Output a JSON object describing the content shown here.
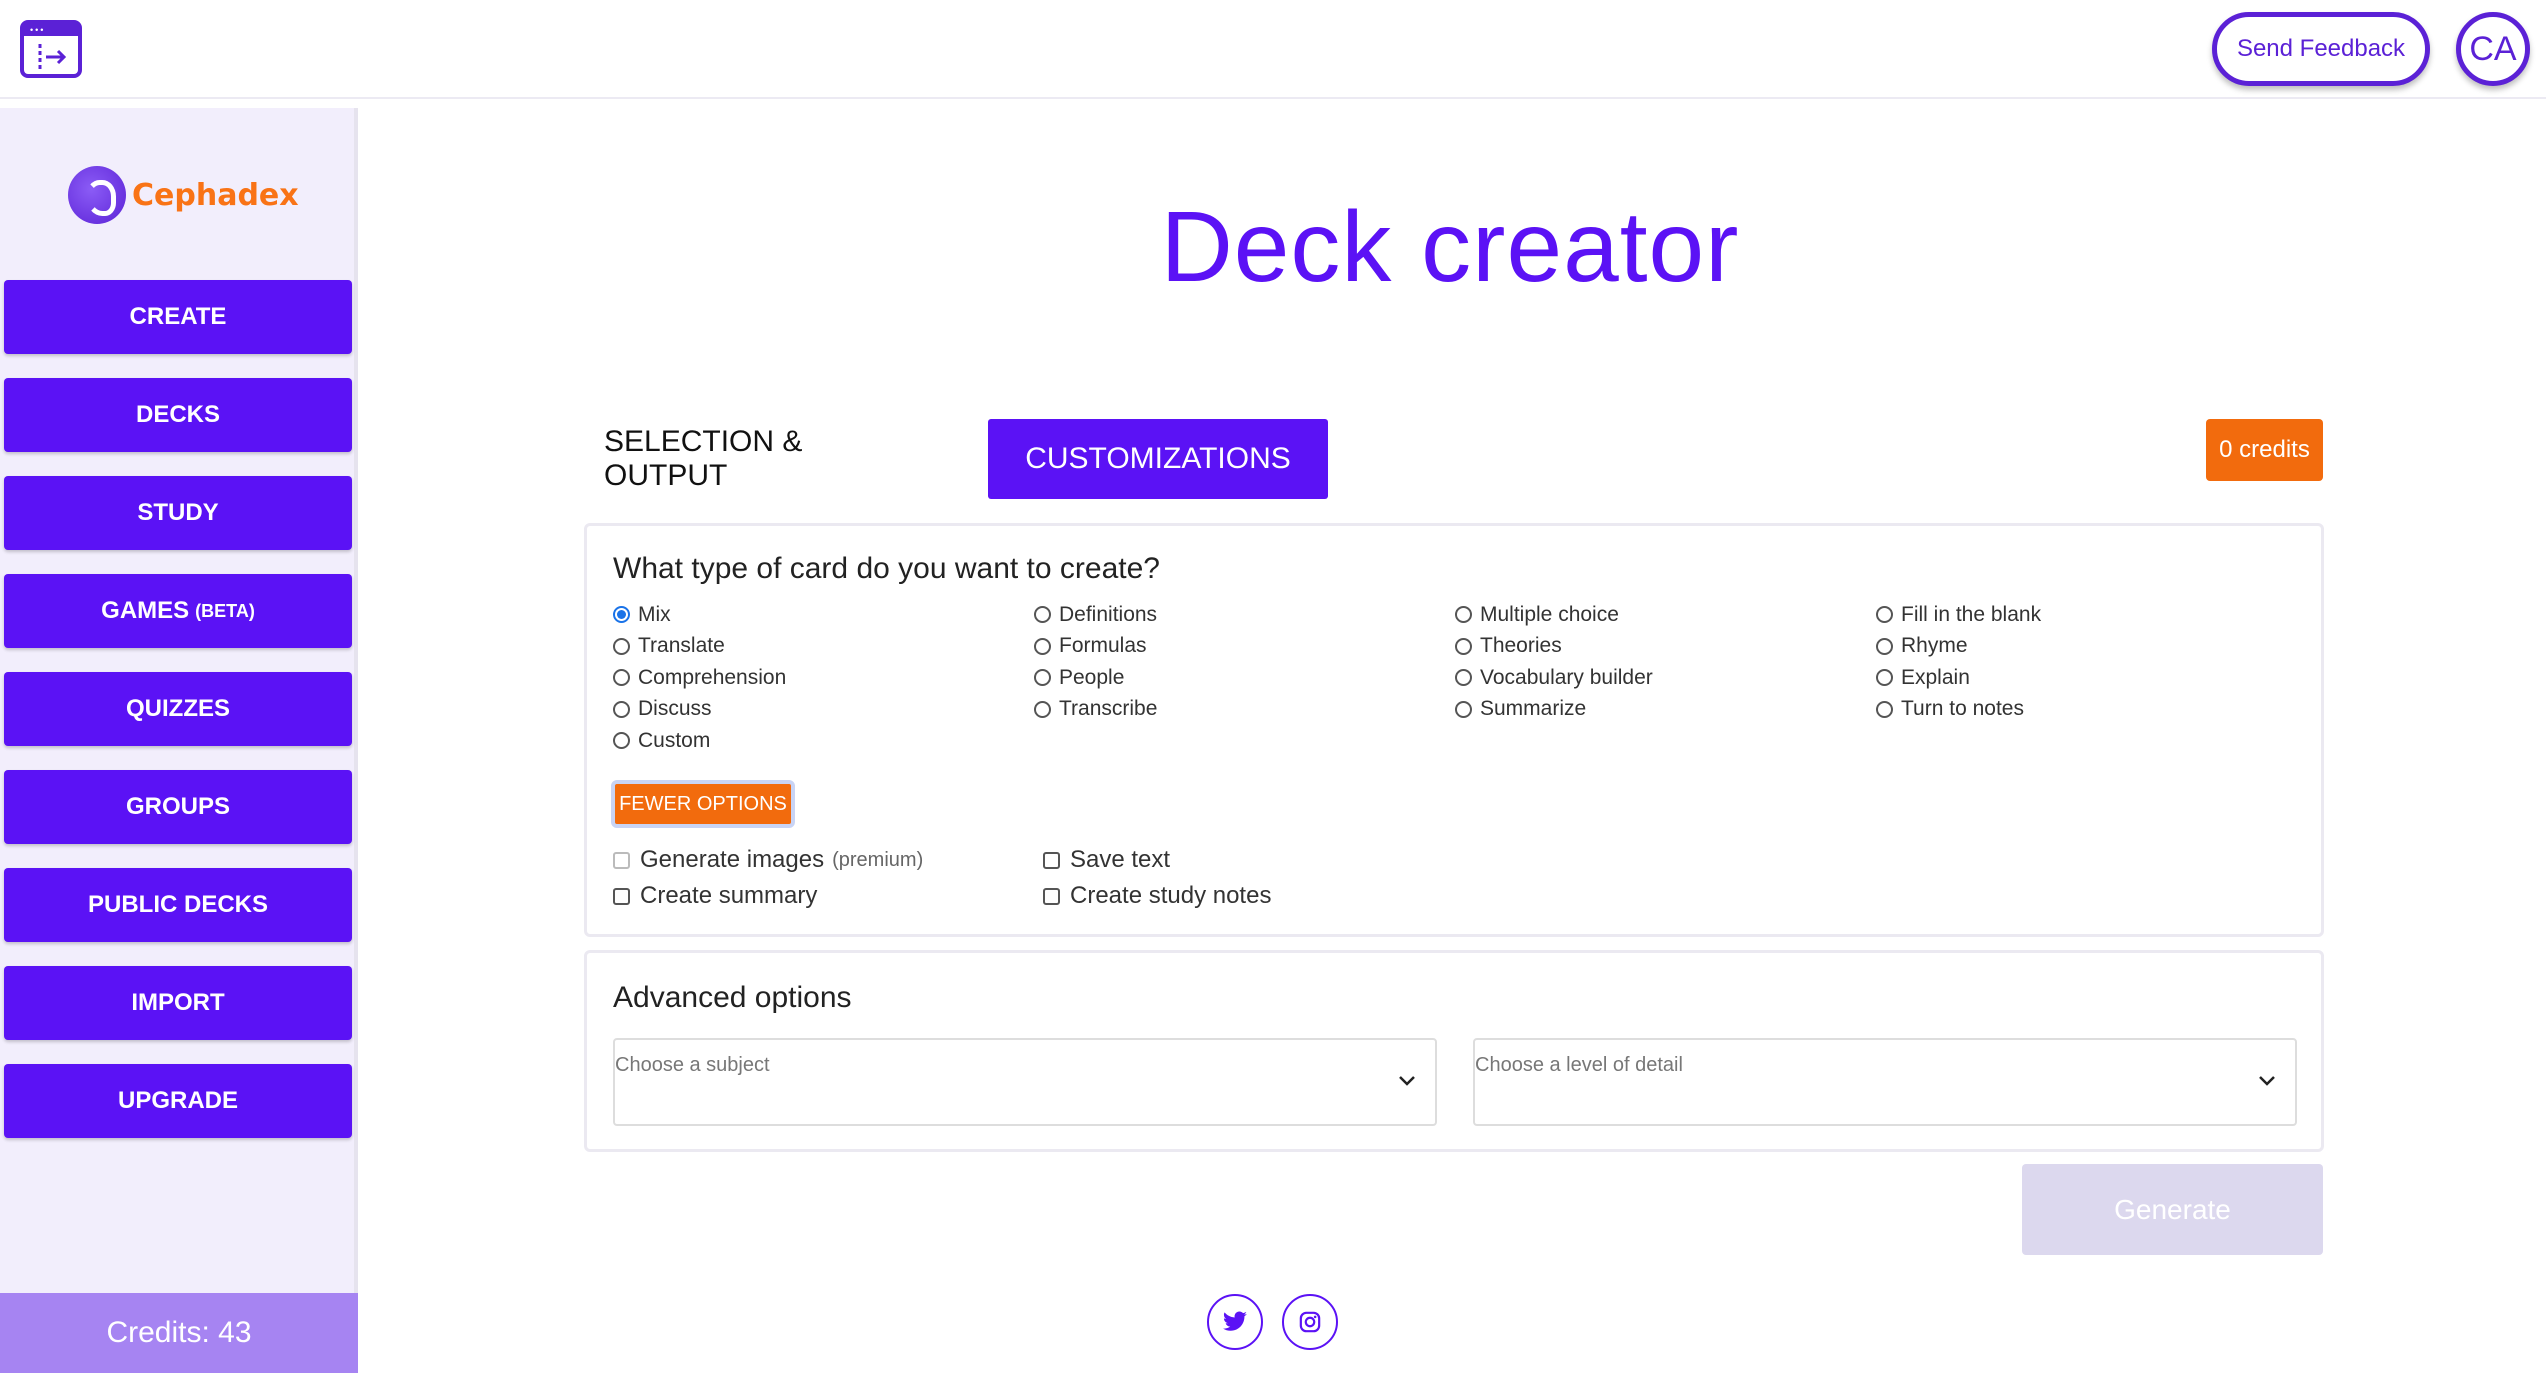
{
  "header": {
    "collapse_icon": "sidebar-collapse-icon",
    "feedback_label": "Send Feedback",
    "avatar_initials": "CA"
  },
  "sidebar": {
    "logo_text": "Cephadex",
    "items": [
      {
        "label": "CREATE",
        "sub": ""
      },
      {
        "label": "DECKS",
        "sub": ""
      },
      {
        "label": "STUDY",
        "sub": ""
      },
      {
        "label": "GAMES",
        "sub": "(BETA)"
      },
      {
        "label": "QUIZZES",
        "sub": ""
      },
      {
        "label": "GROUPS",
        "sub": ""
      },
      {
        "label": "PUBLIC DECKS",
        "sub": ""
      },
      {
        "label": "IMPORT",
        "sub": ""
      },
      {
        "label": "UPGRADE",
        "sub": ""
      }
    ],
    "credits_label": "Credits: 43"
  },
  "main": {
    "title": "Deck creator",
    "tabs": [
      {
        "label": "SELECTION & OUTPUT",
        "active": false
      },
      {
        "label": "CUSTOMIZATIONS",
        "active": true
      }
    ],
    "credits_badge": "0 credits",
    "card_type": {
      "heading": "What type of card do you want to create?",
      "options": [
        [
          "Mix",
          "Definitions",
          "Multiple choice",
          "Fill in the blank"
        ],
        [
          "Translate",
          "Formulas",
          "Theories",
          "Rhyme"
        ],
        [
          "Comprehension",
          "People",
          "Vocabulary builder",
          "Explain"
        ],
        [
          "Discuss",
          "Transcribe",
          "Summarize",
          "Turn to notes"
        ],
        [
          "Custom"
        ]
      ],
      "selected": "Mix",
      "fewer_options_label": "FEWER OPTIONS",
      "checkboxes": {
        "generate_images": "Generate images",
        "premium_note": "(premium)",
        "save_text": "Save text",
        "create_summary": "Create summary",
        "create_study_notes": "Create study notes"
      }
    },
    "advanced": {
      "heading": "Advanced options",
      "subject_placeholder": "Choose a subject",
      "detail_placeholder": "Choose a level of detail"
    },
    "generate_label": "Generate"
  },
  "colors": {
    "brand": "#5b12f5",
    "accent": "#f26b0d",
    "sidebar_bg": "#f2eefc",
    "credits_bar": "#a684f2"
  }
}
